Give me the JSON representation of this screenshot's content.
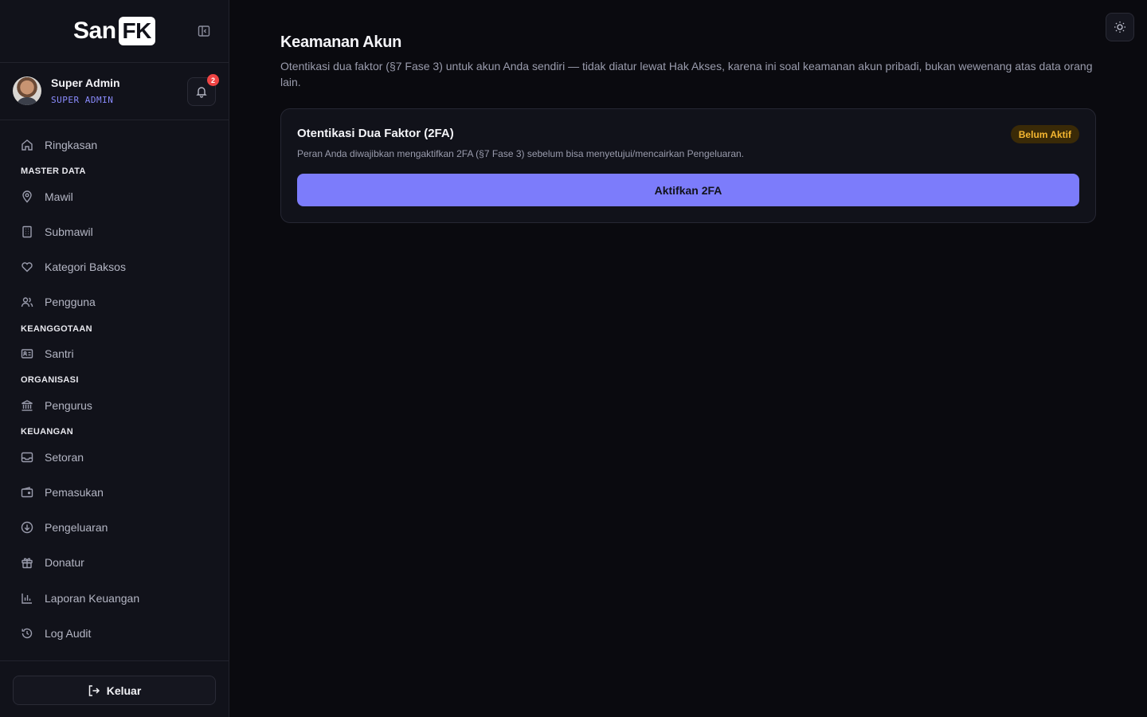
{
  "brand": {
    "logo_left": "San",
    "logo_right": "FK"
  },
  "profile": {
    "name": "Super Admin",
    "role": "SUPER ADMIN",
    "notification_count": "2"
  },
  "sidebar": {
    "items": [
      {
        "label": "Ringkasan",
        "icon": "home-icon"
      },
      {
        "section": "MASTER DATA"
      },
      {
        "label": "Mawil",
        "icon": "map-pin-icon"
      },
      {
        "label": "Submawil",
        "icon": "building-icon"
      },
      {
        "label": "Kategori Baksos",
        "icon": "heart-icon"
      },
      {
        "label": "Pengguna",
        "icon": "users-icon"
      },
      {
        "section": "KEANGGOTAAN"
      },
      {
        "label": "Santri",
        "icon": "id-card-icon"
      },
      {
        "section": "ORGANISASI"
      },
      {
        "label": "Pengurus",
        "icon": "landmark-icon"
      },
      {
        "section": "KEUANGAN"
      },
      {
        "label": "Setoran",
        "icon": "inbox-icon"
      },
      {
        "label": "Pemasukan",
        "icon": "wallet-icon"
      },
      {
        "label": "Pengeluaran",
        "icon": "arrow-down-circle-icon"
      },
      {
        "label": "Donatur",
        "icon": "gift-icon"
      },
      {
        "label": "Laporan Keuangan",
        "icon": "bar-chart-icon"
      },
      {
        "label": "Log Audit",
        "icon": "history-icon"
      }
    ],
    "logout_label": "Keluar"
  },
  "main": {
    "title": "Keamanan Akun",
    "description": "Otentikasi dua faktor (§7 Fase 3) untuk akun Anda sendiri — tidak diatur lewat Hak Akses, karena ini soal keamanan akun pribadi, bukan wewenang atas data orang lain.",
    "card": {
      "title": "Otentikasi Dua Faktor (2FA)",
      "status": "Belum Aktif",
      "description": "Peran Anda diwajibkan mengaktifkan 2FA (§7 Fase 3) sebelum bisa menyetujui/mencairkan Pengeluaran.",
      "button_label": "Aktifkan 2FA"
    }
  },
  "colors": {
    "accent": "#7c7cfb",
    "warning": "#f5b731",
    "danger": "#ef4444"
  }
}
